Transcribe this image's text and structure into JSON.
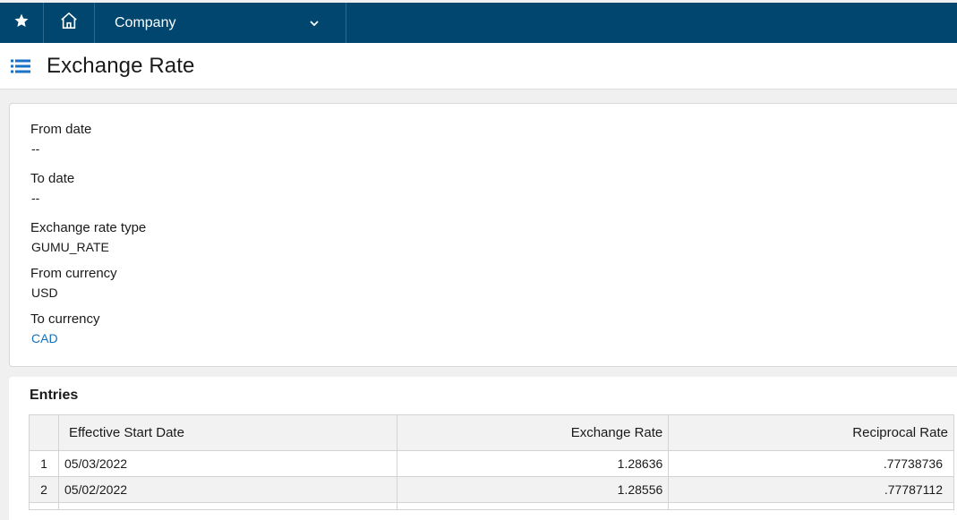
{
  "topbar": {
    "company_label": "Company"
  },
  "page": {
    "title": "Exchange Rate"
  },
  "details": {
    "from_date": {
      "label": "From date",
      "value": "--"
    },
    "to_date": {
      "label": "To date",
      "value": "--"
    },
    "rate_type": {
      "label": "Exchange rate type",
      "value": "GUMU_RATE"
    },
    "from_currency": {
      "label": "From currency",
      "value": "USD"
    },
    "to_currency": {
      "label": "To currency",
      "value": "CAD"
    }
  },
  "entries": {
    "title": "Entries",
    "columns": {
      "start_date": "Effective Start Date",
      "rate": "Exchange Rate",
      "reciprocal": "Reciprocal Rate"
    },
    "rows": [
      {
        "num": "1",
        "date": "05/03/2022",
        "rate": "1.28636",
        "reciprocal": ".77738736"
      },
      {
        "num": "2",
        "date": "05/02/2022",
        "rate": "1.28556",
        "reciprocal": ".77787112"
      }
    ]
  },
  "colors": {
    "topbar": "#00466e",
    "link": "#1570b8",
    "list_icon": "#1a73c7"
  },
  "icons": [
    "star-icon",
    "home-icon",
    "chevron-down-icon",
    "list-icon"
  ]
}
